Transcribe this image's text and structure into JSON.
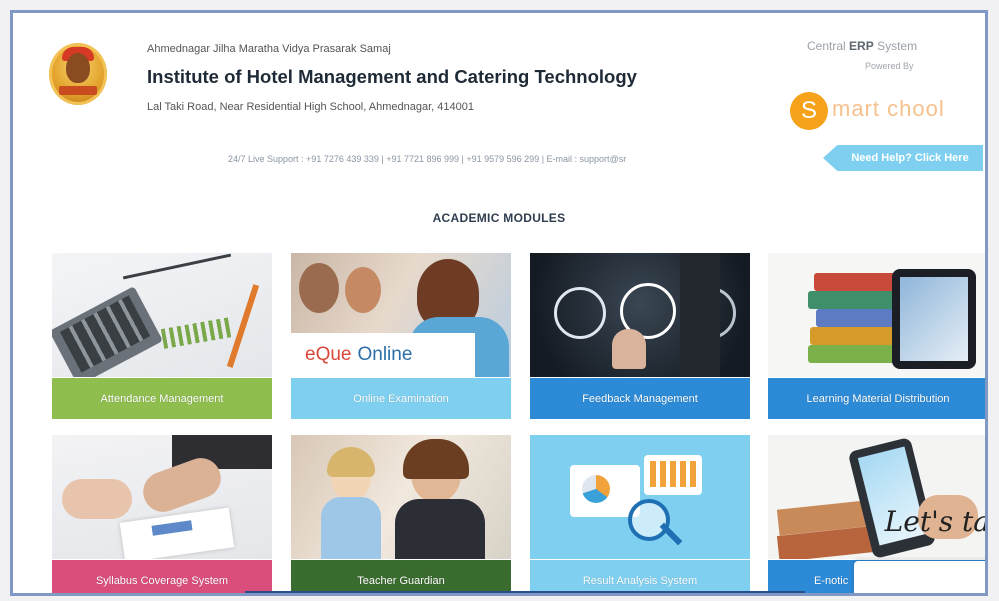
{
  "header": {
    "org_line": "Ahmednagar Jilha Maratha Vidya Prasarak Samaj",
    "institute_title": "Institute of Hotel Management and Catering Technology",
    "address": "Lal Taki Road, Near Residential High School, Ahmednagar, 414001",
    "erp_prefix": "Central",
    "erp_bold": "ERP",
    "erp_suffix": "System",
    "erp_sub": "Powered By",
    "smart_letter": "S",
    "smart_word": "mart chool"
  },
  "support": {
    "text": "24/7 Live Support : +91 7276 439 339 | +91 7721 896 999 | +91 9579 596 299 | E-mail : support@sr",
    "help_button": "Need Help? Click Here"
  },
  "section": {
    "title": "ACADEMIC MODULES"
  },
  "modules": [
    {
      "label": "Attendance Management",
      "color": "#8fbd4e"
    },
    {
      "label": "Online Examination",
      "color": "#7fd0f0"
    },
    {
      "label": "Feedback Management",
      "color": "#2c8ad6"
    },
    {
      "label": "Learning Material Distribution",
      "color": "#2c8ad6"
    },
    {
      "label": "Syllabus Coverage System",
      "color": "#d94e7b"
    },
    {
      "label": "Teacher Guardian",
      "color": "#3a6b2f"
    },
    {
      "label": "Result Analysis System",
      "color": "#7fd0f0"
    },
    {
      "label": "E-notic",
      "color": "#2c8ad6"
    }
  ],
  "overlays": {
    "eque_red": "eQue",
    "eque_blue": "Online",
    "chat_text": "Let's ta"
  }
}
